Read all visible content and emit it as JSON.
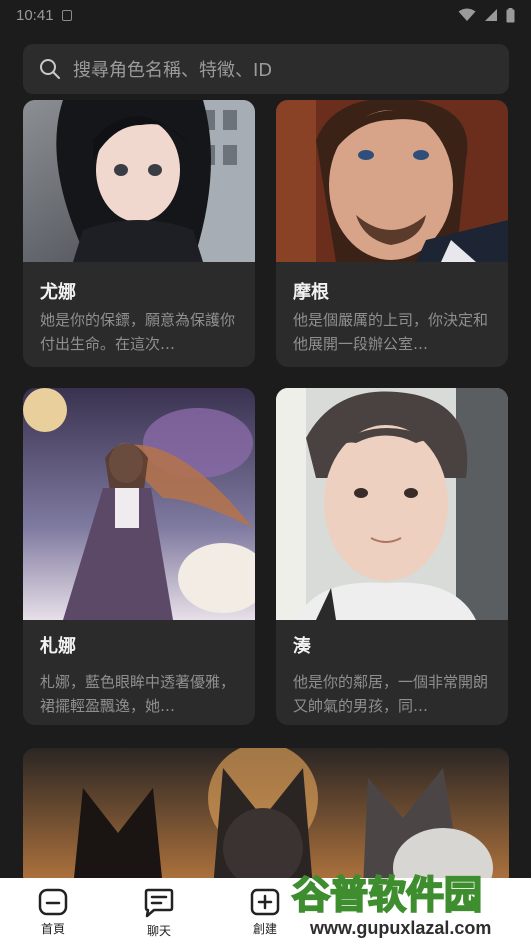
{
  "status_bar": {
    "time": "10:41"
  },
  "search": {
    "placeholder": "搜尋角色名稱、特徵、ID"
  },
  "cards": [
    {
      "name": "尤娜",
      "description": "她是你的保鏢，願意為保護你付出生命。在這次…"
    },
    {
      "name": "摩根",
      "description": "他是個嚴厲的上司，你決定和他展開一段辦公室…"
    },
    {
      "name": "札娜",
      "description": "札娜，藍色眼眸中透著優雅，裙擺輕盈飄逸，她…"
    },
    {
      "name": "湊",
      "description": "他是你的鄰居，一個非常開朗又帥氣的男孩，同…"
    }
  ],
  "bottom_nav": [
    {
      "label": "首頁",
      "icon": "home-icon"
    },
    {
      "label": "聊天",
      "icon": "chat-icon"
    },
    {
      "label": "創建",
      "icon": "create-icon"
    }
  ],
  "watermark": {
    "title": "谷普软件园",
    "url": "www.gupuxlazal.com"
  }
}
